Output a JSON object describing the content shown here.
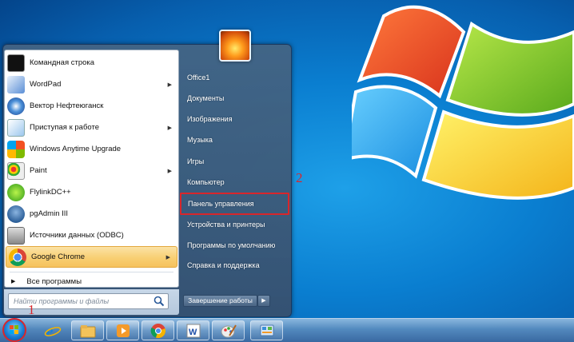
{
  "start_menu": {
    "programs": [
      {
        "label": "Командная строка",
        "icon": "cmd-icon",
        "has_arrow": false
      },
      {
        "label": "WordPad",
        "icon": "wordpad-icon",
        "has_arrow": true
      },
      {
        "label": "Вектор Нефтеюганск",
        "icon": "vector-icon",
        "has_arrow": false
      },
      {
        "label": "Приступая к работе",
        "icon": "getting-started-icon",
        "has_arrow": true
      },
      {
        "label": "Windows Anytime Upgrade",
        "icon": "windows-upgrade-icon",
        "has_arrow": false
      },
      {
        "label": "Paint",
        "icon": "paint-icon",
        "has_arrow": true
      },
      {
        "label": "FlylinkDC++",
        "icon": "flylink-icon",
        "has_arrow": false
      },
      {
        "label": "pgAdmin III",
        "icon": "pgadmin-icon",
        "has_arrow": false
      },
      {
        "label": "Источники данных (ODBC)",
        "icon": "odbc-icon",
        "has_arrow": false
      },
      {
        "label": "Google Chrome",
        "icon": "chrome-icon",
        "has_arrow": true
      }
    ],
    "all_programs": "Все программы",
    "search_placeholder": "Найти программы и файлы",
    "right_links": [
      "Office1",
      "Документы",
      "Изображения",
      "Музыка",
      "Игры",
      "Компьютер",
      "Панель управления",
      "Устройства и принтеры",
      "Программы по умолчанию",
      "Справка и поддержка"
    ],
    "shutdown_label": "Завершение работы"
  },
  "annotations": {
    "marker_1": "1",
    "marker_2": "2"
  },
  "colors": {
    "highlight_border": "#d9262b",
    "menu_highlight": "#f8cf73"
  },
  "taskbar": {
    "items": [
      "internet-explorer-icon",
      "explorer-folder-icon",
      "media-player-icon",
      "chrome-icon",
      "word-icon",
      "paint-icon",
      "control-panel-icon"
    ]
  }
}
